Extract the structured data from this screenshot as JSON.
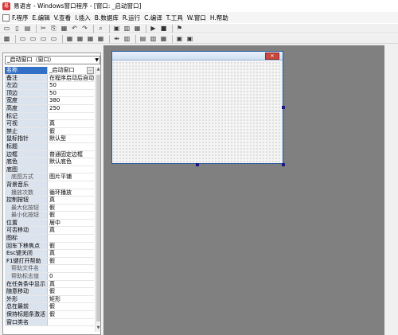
{
  "window": {
    "title": "易语言 - Windows窗口程序 - [窗口: _启动窗口]",
    "icon_label": "易"
  },
  "menu": [
    "F.程序",
    "E.编辑",
    "V.查看",
    "I.插入",
    "B.数据库",
    "R.运行",
    "C.编译",
    "T.工具",
    "W.窗口",
    "H.帮助"
  ],
  "toolbar1": [
    "new-icon",
    "open-icon",
    "save-icon",
    "|",
    "cut-icon",
    "copy-icon",
    "paste-icon",
    "undo-icon",
    "redo-icon",
    "|",
    "find-icon",
    "|",
    "layout1-icon",
    "layout2-icon",
    "layout3-icon",
    "|",
    "run-icon",
    "stop-icon",
    "|",
    "debug-icon"
  ],
  "toolbar1_glyphs": [
    "▭",
    "▯",
    "▤",
    "|",
    "✂",
    "⎘",
    "▦",
    "↶",
    "↷",
    "|",
    "⌕",
    "|",
    "▣",
    "▥",
    "▦",
    "|",
    "▶",
    "■",
    "|",
    "⚑"
  ],
  "toolbar2_glyphs": [
    "▩",
    "|",
    "▭",
    "▭",
    "▭",
    "▭",
    "|",
    "▦",
    "▦",
    "▦",
    "▦",
    "|",
    "⇹",
    "▥",
    "|",
    "▤",
    "▥",
    "▦",
    "|",
    "▣",
    "▣"
  ],
  "property_panel": {
    "selector": "_启动窗口（窗口）",
    "rows": [
      {
        "name": "名称",
        "value": "_启动窗口",
        "selected": true,
        "button": "..."
      },
      {
        "name": "备注",
        "value": "在程序启动后自动"
      },
      {
        "name": "左边",
        "value": "50"
      },
      {
        "name": "顶边",
        "value": "50"
      },
      {
        "name": "宽度",
        "value": "380"
      },
      {
        "name": "高度",
        "value": "250"
      },
      {
        "name": "标记",
        "value": ""
      },
      {
        "name": "可视",
        "value": "真"
      },
      {
        "name": "禁止",
        "value": "假"
      },
      {
        "name": "鼠标指针",
        "value": "默认型"
      },
      {
        "name": "标题",
        "value": ""
      },
      {
        "name": "边框",
        "value": "普通固定边框"
      },
      {
        "name": "底色",
        "value": "默认底色"
      },
      {
        "name": "底图",
        "value": ""
      },
      {
        "name": "底图方式",
        "value": "图片平铺",
        "sub": true
      },
      {
        "name": "背景音乐",
        "value": ""
      },
      {
        "name": "播放次数",
        "value": "循环播放",
        "sub": true
      },
      {
        "name": "控制按钮",
        "value": "真"
      },
      {
        "name": "最大化按钮",
        "value": "假",
        "sub": true
      },
      {
        "name": "最小化按钮",
        "value": "假",
        "sub": true
      },
      {
        "name": "位置",
        "value": "居中"
      },
      {
        "name": "可否移动",
        "value": "真"
      },
      {
        "name": "图标",
        "value": ""
      },
      {
        "name": "回车下移焦点",
        "value": "假"
      },
      {
        "name": "Esc键关闭",
        "value": "真"
      },
      {
        "name": "F1键打开帮助",
        "value": "假"
      },
      {
        "name": "帮助文件名",
        "value": "",
        "sub": true
      },
      {
        "name": "帮助标志值",
        "value": "0",
        "sub": true
      },
      {
        "name": "在任务条中显示",
        "value": "真"
      },
      {
        "name": "随意移动",
        "value": "假"
      },
      {
        "name": "外形",
        "value": "矩形"
      },
      {
        "name": "总在最前",
        "value": "假"
      },
      {
        "name": "保持标题条激活",
        "value": "假"
      },
      {
        "name": "窗口类名",
        "value": ""
      }
    ]
  },
  "designer": {
    "close_glyph": "✕"
  }
}
